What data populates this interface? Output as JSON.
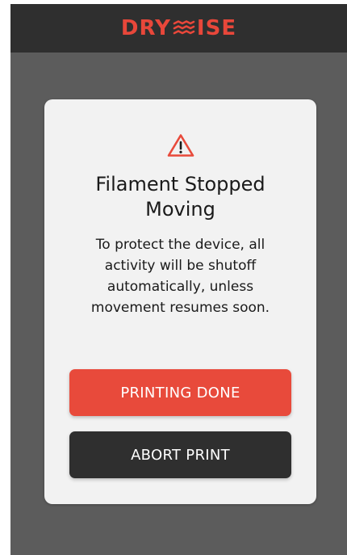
{
  "header": {
    "brand_left": "DRY",
    "brand_right": "ISE",
    "logo_icon": "wave-icon",
    "brand_color": "#e8473a",
    "background": "#2f2f2f"
  },
  "modal": {
    "icon": "warning-triangle-icon",
    "title": "Filament Stopped Moving",
    "message": "To protect the device, all activity will be shutoff automatically, unless movement resumes soon.",
    "primary_button": "PRINTING DONE",
    "secondary_button": "ABORT PRINT",
    "primary_color": "#e84a3b",
    "secondary_color": "#2f2f2f"
  }
}
